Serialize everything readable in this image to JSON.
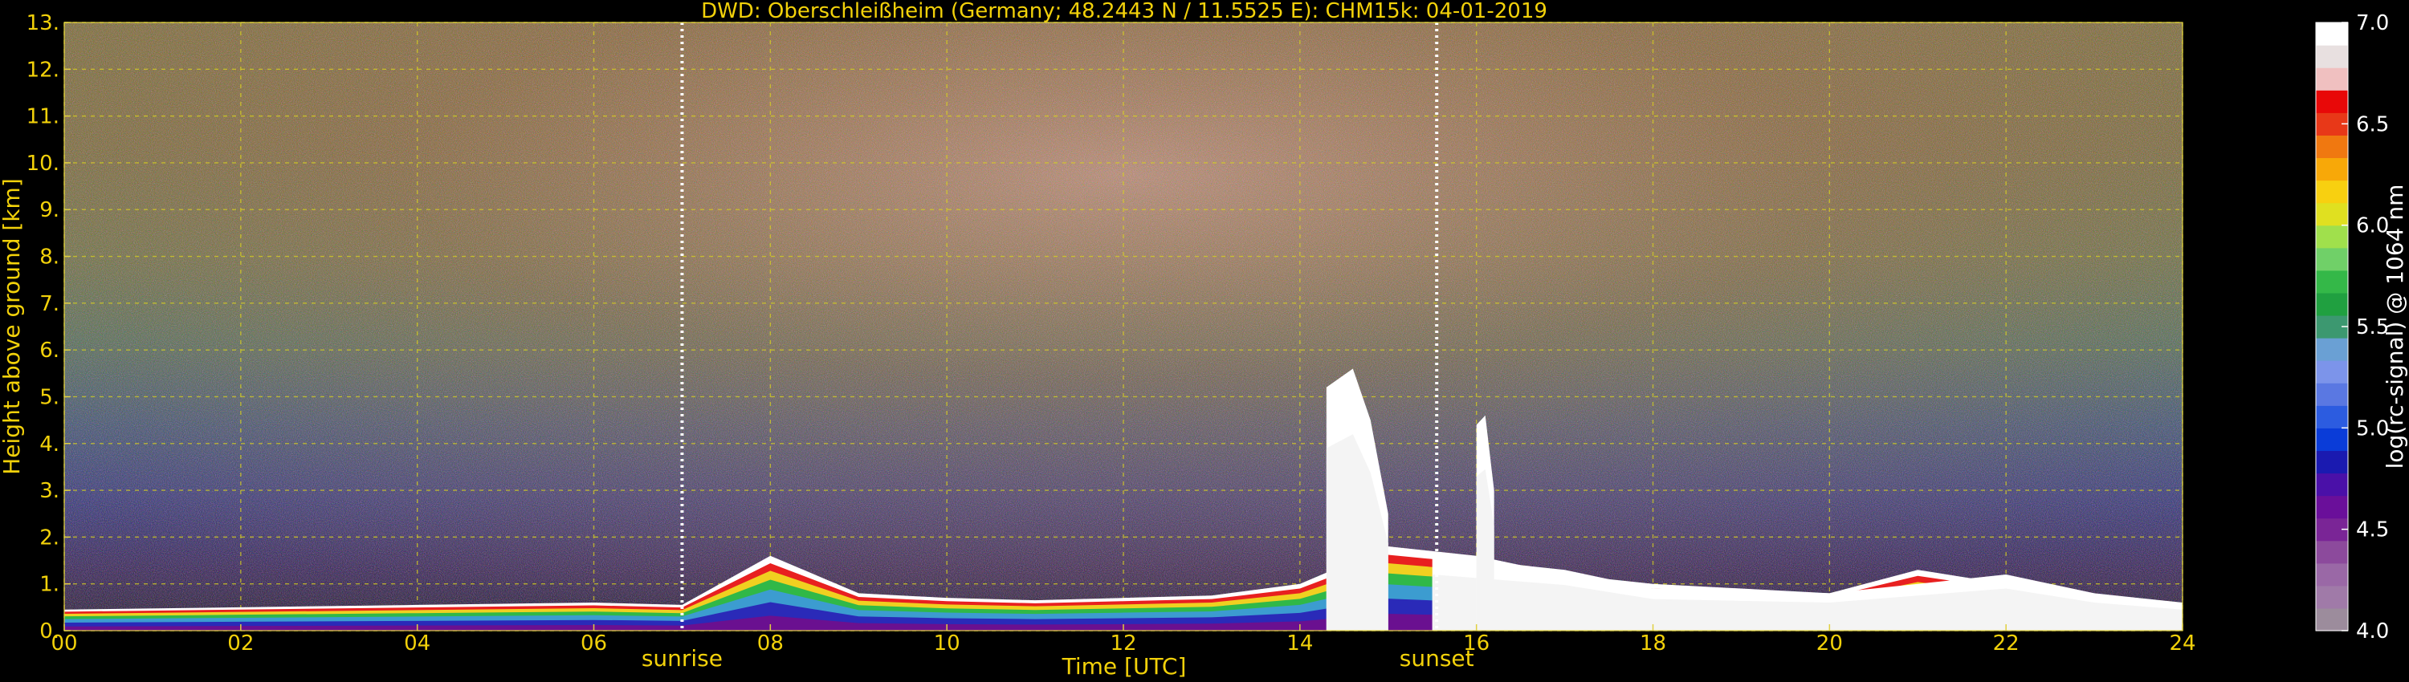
{
  "chart_data": {
    "type": "heatmap",
    "title": "DWD: Oberschleißheim (Germany; 48.2443 N / 11.5525 E):    CHM15k: 04-01-2019",
    "xlabel": "Time [UTC]",
    "ylabel": "Height above ground [km]",
    "xlim": [
      0,
      24
    ],
    "ylim": [
      0,
      13
    ],
    "x_ticks": [
      "00",
      "02",
      "04",
      "06",
      "08",
      "10",
      "12",
      "14",
      "16",
      "18",
      "20",
      "22",
      "24"
    ],
    "y_ticks": [
      "0.",
      "1.",
      "2.",
      "3.",
      "4.",
      "5.",
      "6.",
      "7.",
      "8.",
      "9.",
      "10.",
      "11.",
      "12.",
      "13."
    ],
    "grid": true,
    "annotations": [
      {
        "text": "sunrise",
        "x": 7.0
      },
      {
        "text": "sunset",
        "x": 15.55
      }
    ],
    "colorbar": {
      "label": "log(rc-signal) @ 1064 nm",
      "range": [
        4.0,
        7.0
      ],
      "ticks": [
        "4.0",
        "4.5",
        "5.0",
        "5.5",
        "6.0",
        "6.5",
        "7.0"
      ],
      "colors": [
        "#9c8c9c",
        "#a07aa8",
        "#9a68a6",
        "#8c4a9c",
        "#7a2596",
        "#6a0f9a",
        "#4a10a8",
        "#1a1ab0",
        "#0a3cd8",
        "#2c5ce0",
        "#5a78e2",
        "#7c94ea",
        "#6aa0d4",
        "#3c9870",
        "#20a040",
        "#34b848",
        "#70d068",
        "#a0e04c",
        "#e0e020",
        "#f8d010",
        "#f8a808",
        "#f07810",
        "#e83818",
        "#e80808",
        "#f0c0c0",
        "#e8e0e0",
        "#ffffff"
      ]
    },
    "layers": [
      {
        "name": "boundary layer",
        "x": [
          0,
          2,
          4,
          6,
          7,
          8,
          9,
          10,
          11,
          12,
          13,
          14,
          15,
          16,
          17,
          18,
          19,
          20,
          21,
          22,
          23,
          24
        ],
        "top_km": [
          0.45,
          0.5,
          0.55,
          0.6,
          0.55,
          1.6,
          0.8,
          0.7,
          0.65,
          0.7,
          0.75,
          1.0,
          1.8,
          1.6,
          1.2,
          1.0,
          0.9,
          0.8,
          1.3,
          1.0,
          0.7,
          0.6
        ]
      },
      {
        "name": "cloud",
        "x": [
          14.3,
          14.6,
          14.8,
          15.0
        ],
        "top_km": [
          5.2,
          5.6,
          4.5,
          2.5
        ]
      },
      {
        "name": "cloud",
        "x": [
          15.5,
          16.0,
          17.0,
          18.0,
          19.0,
          20.0,
          21.0,
          22.0,
          23.0,
          24.0
        ],
        "top_km": [
          1.6,
          1.5,
          1.3,
          0.9,
          0.85,
          0.8,
          1.0,
          1.2,
          0.8,
          0.6
        ]
      },
      {
        "name": "cloud",
        "x": [
          16.0,
          16.1,
          16.2
        ],
        "top_km": [
          4.4,
          4.6,
          3.0
        ]
      }
    ]
  }
}
